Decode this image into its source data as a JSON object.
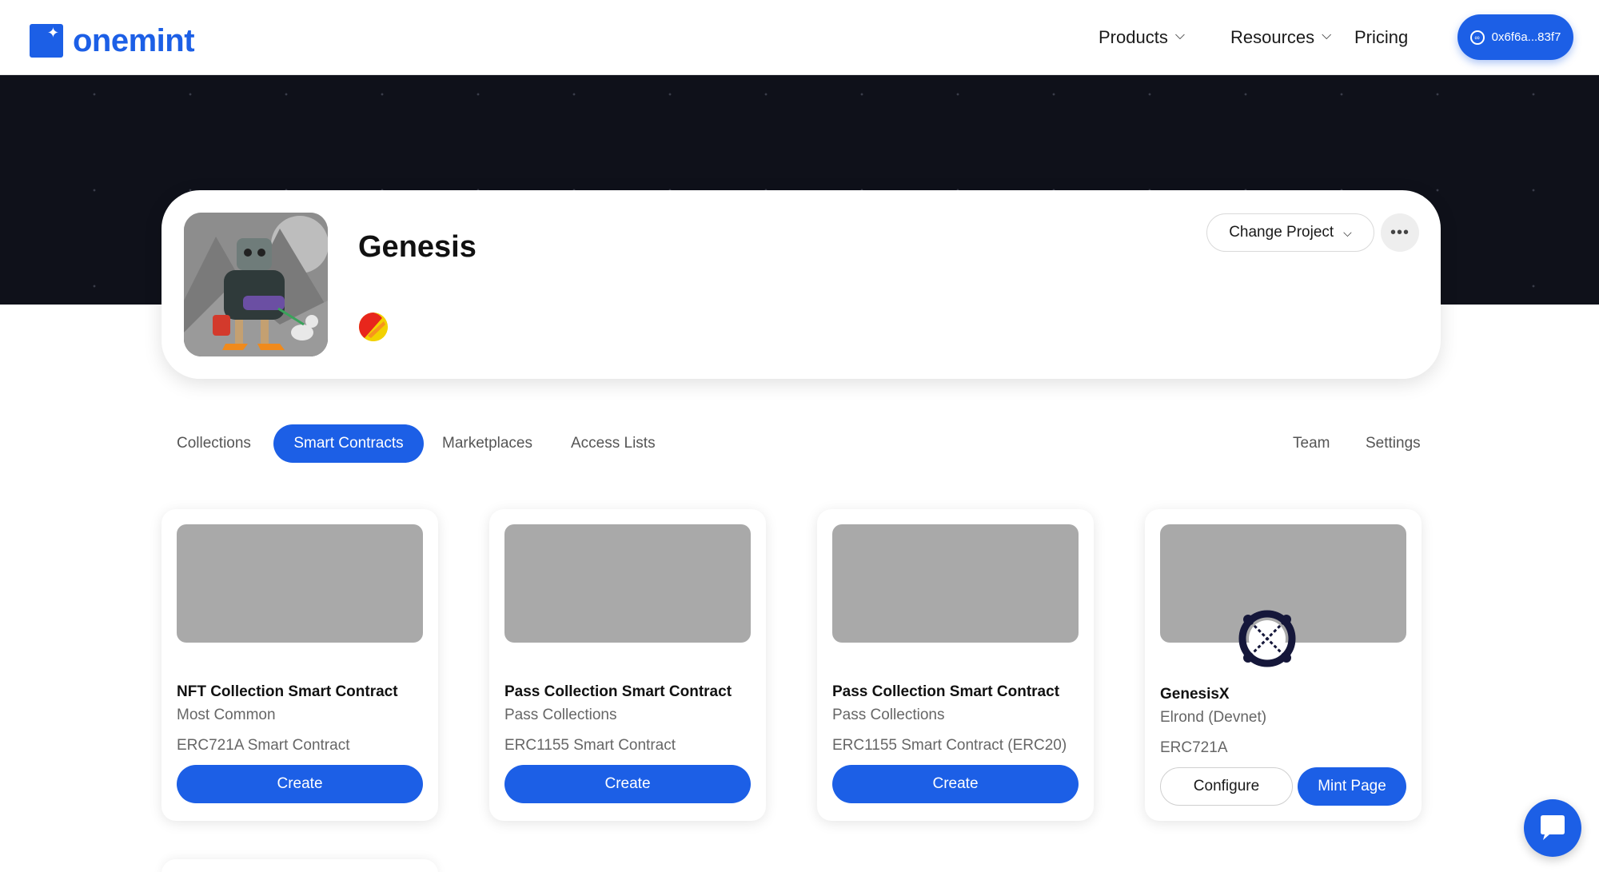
{
  "header": {
    "logo_text": "onemint",
    "nav": {
      "products": "Products",
      "resources": "Resources",
      "pricing": "Pricing"
    },
    "wallet_address": "0x6f6a...83f7"
  },
  "project": {
    "name": "Genesis",
    "change_project_label": "Change Project"
  },
  "tabs": {
    "collections": "Collections",
    "smart_contracts": "Smart Contracts",
    "marketplaces": "Marketplaces",
    "access_lists": "Access Lists",
    "team": "Team",
    "settings": "Settings",
    "active": "Smart Contracts"
  },
  "contracts": [
    {
      "title": "NFT Collection Smart Contract",
      "subtitle": "Most Common",
      "type": "ERC721A Smart Contract",
      "button": "Create"
    },
    {
      "title": "Pass Collection Smart Contract",
      "subtitle": "Pass Collections",
      "type": "ERC1155 Smart Contract",
      "button": "Create"
    },
    {
      "title": "Pass Collection Smart Contract",
      "subtitle": "Pass Collections",
      "type": "ERC1155 Smart Contract (ERC20)",
      "button": "Create"
    },
    {
      "title": "GenesisX",
      "subtitle": "Elrond (Devnet)",
      "type": "ERC721A",
      "configure_button": "Configure",
      "mint_button": "Mint Page"
    }
  ],
  "colors": {
    "primary": "#1c5fe6",
    "banner": "#0f111a",
    "placeholder": "#a9a9a9"
  },
  "icons": {
    "wallet": "wallet-icon",
    "chain": "chain-icon",
    "elrond": "elrond-logo-icon",
    "chat": "chat-icon"
  }
}
